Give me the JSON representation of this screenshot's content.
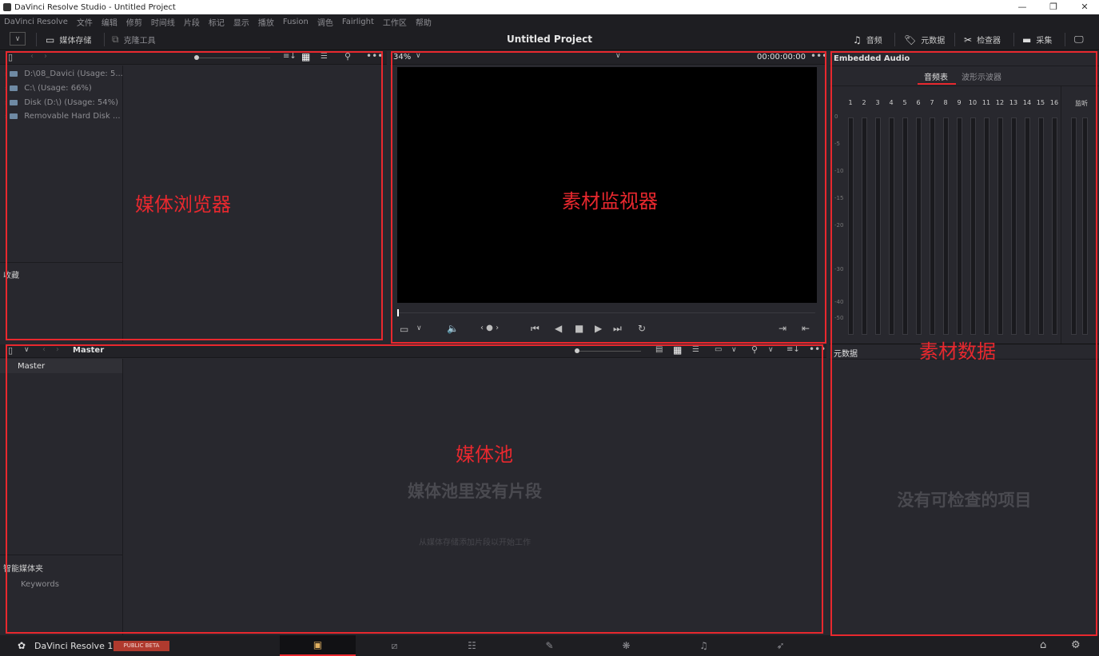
{
  "window": {
    "title": "DaVinci Resolve Studio - Untitled Project",
    "controls": [
      "—",
      "❐",
      "✕"
    ]
  },
  "menu": [
    "DaVinci Resolve",
    "文件",
    "编辑",
    "修剪",
    "时间线",
    "片段",
    "标记",
    "显示",
    "播放",
    "Fusion",
    "调色",
    "Fairlight",
    "工作区",
    "帮助"
  ],
  "toolbar": {
    "media_storage": "媒体存储",
    "clone_tool": "克隆工具",
    "project_title": "Untitled Project",
    "audio": "音频",
    "metadata": "元数据",
    "inspector": "检查器",
    "capture": "采集"
  },
  "media_browser": {
    "drives": [
      "D:\\08_Davici (Usage: 5...",
      "C:\\ (Usage: 66%)",
      "Disk (D:\\) (Usage: 54%)",
      "Removable Hard Disk ..."
    ],
    "favorites": "收藏",
    "annotation": "媒体浏览器"
  },
  "viewer": {
    "zoom": "34%",
    "timecode": "00:00:00:00",
    "annotation": "素材监视器"
  },
  "audio_panel": {
    "title": "Embedded Audio",
    "tab_meters": "音频表",
    "tab_waveform": "波形示波器",
    "channels": [
      "1",
      "2",
      "3",
      "4",
      "5",
      "6",
      "7",
      "8",
      "9",
      "10",
      "11",
      "12",
      "13",
      "14",
      "15",
      "16"
    ],
    "monitor": "监听",
    "db_scale": [
      "0",
      "-5",
      "-10",
      "-15",
      "-20",
      "-30",
      "-40",
      "-50"
    ]
  },
  "metadata_panel": {
    "title": "元数据",
    "empty": "没有可检查的项目",
    "annotation": "素材数据"
  },
  "media_pool": {
    "breadcrumb": "Master",
    "bin_master": "Master",
    "smart_bins": "智能媒体夹",
    "keywords": "Keywords",
    "empty_title": "媒体池里没有片段",
    "empty_sub": "从媒体存储添加片段以开始工作",
    "annotation": "媒体池"
  },
  "bottom": {
    "app_name": "DaVinci Resolve 18",
    "badge": "PUBLIC BETA"
  },
  "colors": {
    "accent_red": "#e8282e",
    "badge_bg": "#b03a2e"
  }
}
